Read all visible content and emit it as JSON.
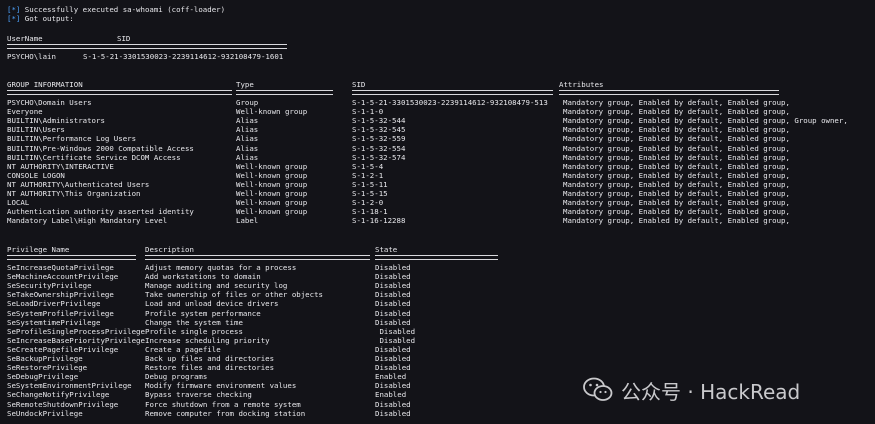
{
  "output": {
    "line1_prefix": "[*]",
    "line1_text": " Successfully executed sa-whoami (coff-loader)",
    "line2_prefix": "[*]",
    "line2_text": " Got output:"
  },
  "user": {
    "headers": [
      "UserName",
      "SID"
    ],
    "values": [
      "PSYCHO\\lain",
      "S-1-5-21-3301530023-2239114612-932108479-1601"
    ]
  },
  "groups": {
    "headers": [
      "GROUP INFORMATION",
      "Type",
      "SID",
      "Attributes"
    ],
    "rows": [
      [
        "PSYCHO\\Domain Users",
        "Group",
        "S-1-5-21-3301530023-2239114612-932108479-513",
        "Mandatory group, Enabled by default, Enabled group,"
      ],
      [
        "Everyone",
        "Well-known group",
        "S-1-1-0",
        "Mandatory group, Enabled by default, Enabled group,"
      ],
      [
        "BUILTIN\\Administrators",
        "Alias",
        "S-1-5-32-544",
        "Mandatory group, Enabled by default, Enabled group, Group owner,"
      ],
      [
        "BUILTIN\\Users",
        "Alias",
        "S-1-5-32-545",
        "Mandatory group, Enabled by default, Enabled group,"
      ],
      [
        "BUILTIN\\Performance Log Users",
        "Alias",
        "S-1-5-32-559",
        "Mandatory group, Enabled by default, Enabled group,"
      ],
      [
        "BUILTIN\\Pre-Windows 2000 Compatible Access",
        "Alias",
        "S-1-5-32-554",
        "Mandatory group, Enabled by default, Enabled group,"
      ],
      [
        "BUILTIN\\Certificate Service DCOM Access",
        "Alias",
        "S-1-5-32-574",
        "Mandatory group, Enabled by default, Enabled group,"
      ],
      [
        "NT AUTHORITY\\INTERACTIVE",
        "Well-known group",
        "S-1-5-4",
        "Mandatory group, Enabled by default, Enabled group,"
      ],
      [
        "CONSOLE LOGON",
        "Well-known group",
        "S-1-2-1",
        "Mandatory group, Enabled by default, Enabled group,"
      ],
      [
        "NT AUTHORITY\\Authenticated Users",
        "Well-known group",
        "S-1-5-11",
        "Mandatory group, Enabled by default, Enabled group,"
      ],
      [
        "NT AUTHORITY\\This Organization",
        "Well-known group",
        "S-1-5-15",
        "Mandatory group, Enabled by default, Enabled group,"
      ],
      [
        "LOCAL",
        "Well-known group",
        "S-1-2-0",
        "Mandatory group, Enabled by default, Enabled group,"
      ],
      [
        "Authentication authority asserted identity",
        "Well-known group",
        "S-1-18-1",
        "Mandatory group, Enabled by default, Enabled group,"
      ],
      [
        "Mandatory Label\\High Mandatory Level",
        "Label",
        "S-1-16-12288",
        "Mandatory group, Enabled by default, Enabled group,"
      ]
    ]
  },
  "privileges": {
    "headers": [
      "Privilege Name",
      "Description",
      "State"
    ],
    "rows": [
      [
        "SeIncreaseQuotaPrivilege",
        "Adjust memory quotas for a process",
        "Disabled"
      ],
      [
        "SeMachineAccountPrivilege",
        "Add workstations to domain",
        "Disabled"
      ],
      [
        "SeSecurityPrivilege",
        "Manage auditing and security log",
        "Disabled"
      ],
      [
        "SeTakeOwnershipPrivilege",
        "Take ownership of files or other objects",
        "Disabled"
      ],
      [
        "SeLoadDriverPrivilege",
        "Load and unload device drivers",
        "Disabled"
      ],
      [
        "SeSystemProfilePrivilege",
        "Profile system performance",
        "Disabled"
      ],
      [
        "SeSystemtimePrivilege",
        "Change the system time",
        "Disabled"
      ],
      [
        "SeProfileSingleProcessPrivilege",
        "Profile single process",
        " Disabled"
      ],
      [
        "SeIncreaseBasePriorityPrivilege",
        "Increase scheduling priority",
        " Disabled"
      ],
      [
        "SeCreatePagefilePrivilege",
        "Create a pagefile",
        "Disabled"
      ],
      [
        "SeBackupPrivilege",
        "Back up files and directories",
        "Disabled"
      ],
      [
        "SeRestorePrivilege",
        "Restore files and directories",
        "Disabled"
      ],
      [
        "SeDebugPrivilege",
        "Debug programs",
        "Enabled"
      ],
      [
        "SeSystemEnvironmentPrivilege",
        "Modify firmware environment values",
        "Disabled"
      ],
      [
        "SeChangeNotifyPrivilege",
        "Bypass traverse checking",
        "Enabled"
      ],
      [
        "SeRemoteShutdownPrivilege",
        "Force shutdown from a remote system",
        "Disabled"
      ],
      [
        "SeUndockPrivilege",
        "Remove computer from docking station",
        "Disabled"
      ]
    ]
  },
  "watermark": {
    "icon": "wechat-icon",
    "text": "公众号 · HackRead"
  },
  "colors": {
    "background": "#131318",
    "text": "#e8e8ec",
    "accent": "#4da3ff"
  }
}
